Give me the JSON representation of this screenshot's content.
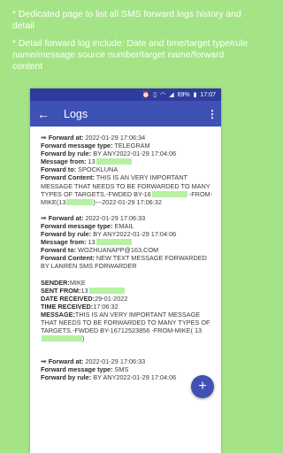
{
  "promo": {
    "line1": "* Dedicated page to list all SMS forward logs history and detail",
    "line2": "* Detail forward log include: Date and time/target type/rule name/message source number/target name/forward content"
  },
  "statusbar": {
    "icons": [
      "alarm-icon",
      "vibrate-icon",
      "wifi-icon",
      "signal-icon",
      "battery-icon"
    ],
    "battery": "69%",
    "time": "17:07"
  },
  "appbar": {
    "title": "Logs"
  },
  "logs": [
    {
      "forward_at_label": "Forward at:",
      "forward_at": "2022-01-29 17:06:34",
      "type_label": "Forward message type:",
      "type": "TELEGRAM",
      "rule_label": "Forward by rule:",
      "rule": "BY ANY2022-01-29 17:04:06",
      "from_label": "Message from:",
      "from": "13",
      "to_label": "Forward to:",
      "to": "SPOCKLUNA",
      "content_label": "Forward Content:",
      "content_a": "THIS IS AN VERY IMPORTANT MESSAGE THAT NEEDS TO BE FORWARDED TO MANY TYPES OF TARGETS.-FWDED BY-16",
      "content_b": "-FROM-MIKE(13",
      "content_c": ")---2022-01-29 17:06:32"
    },
    {
      "forward_at_label": "Forward at:",
      "forward_at": "2022-01-29 17:06:33",
      "type_label": "Forward message type:",
      "type": "EMAIL",
      "rule_label": "Forward by rule:",
      "rule": "BY ANY2022-01-29 17:04:06",
      "from_label": "Message from:",
      "from": "13",
      "to_label": "Forward to:",
      "to": "WOZHUANAPP@163.COM",
      "content_label": "Forward Content:",
      "content": "NEW TEXT MESSAGE FORWARDED BY LANREN SMS FORWARDER"
    },
    {
      "forward_at_label": "Forward at:",
      "forward_at": "2022-01-29 17:06:33",
      "type_label": "Forward message type:",
      "type": "SMS",
      "rule_label": "Forward by rule:",
      "rule": "BY ANY2022-01-29 17:04:06"
    }
  ],
  "sms_detail": {
    "sender_label": "SENDER:",
    "sender": "MIKE",
    "sent_from_label": "SENT FROM:",
    "sent_from": "13",
    "date_label": "DATE RECEIVED:",
    "date": "29-01-2022",
    "time_label": "TIME RECEIVED:",
    "time": "17:06:32",
    "message_label": "MESSAGE:",
    "message": "THIS IS AN VERY IMPORTANT MESSAGE THAT NEEDS TO BE FORWARDED TO MANY TYPES OF TARGETS.-FWDED BY-16712523856 -FROM-MIKE( 13",
    "message_end": ")"
  },
  "fab": {
    "label": "+"
  },
  "colors": {
    "background": "#a5e486",
    "statusbar": "#2f3c9e",
    "appbar": "#3f51b5",
    "redaction": "#b6f2a2"
  }
}
